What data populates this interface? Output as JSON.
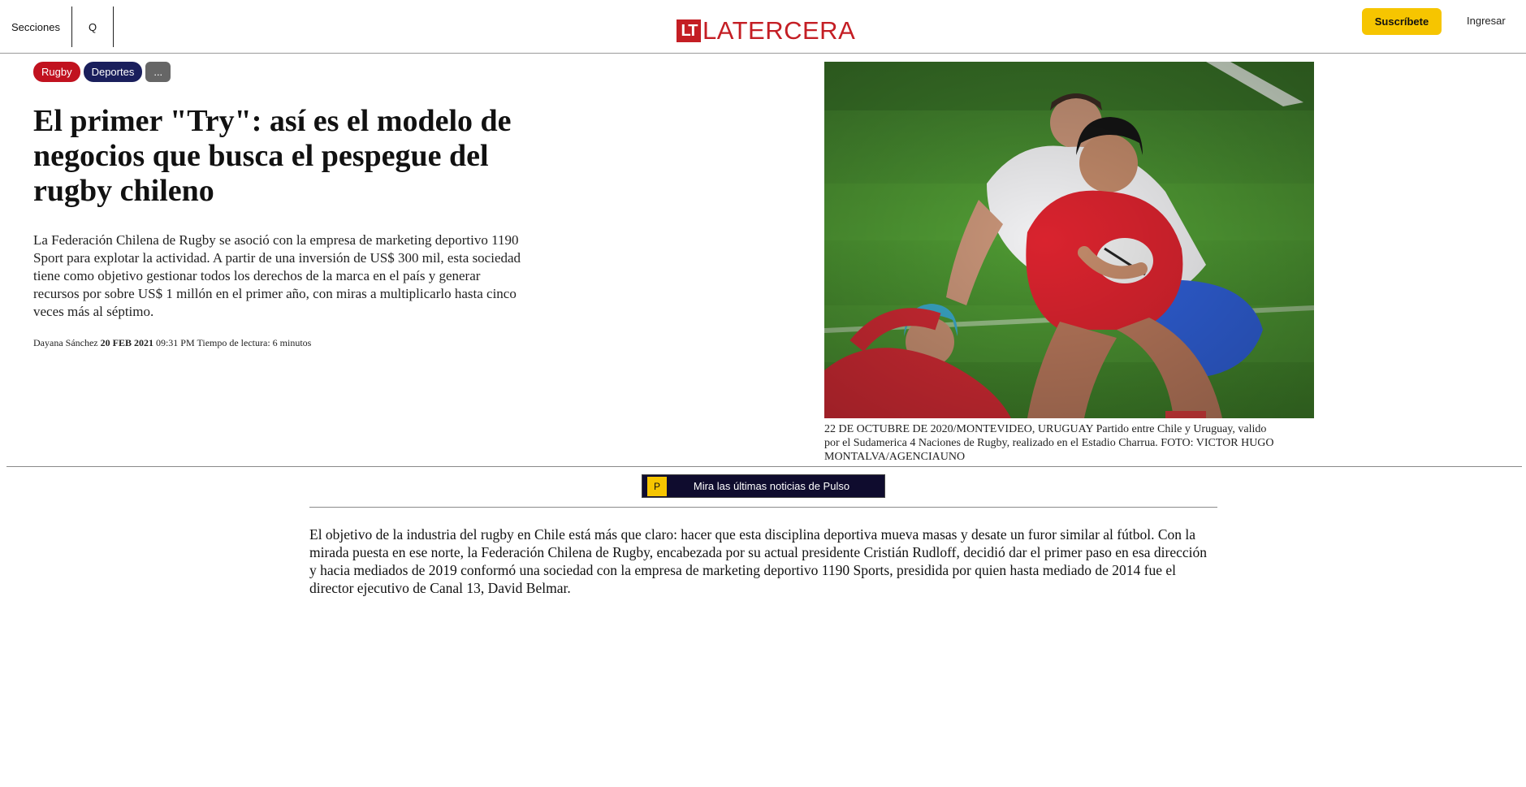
{
  "header": {
    "sections_label": "Secciones",
    "search_label": "Q",
    "logo_mark": "LT",
    "logo_text": "LATERCERA",
    "subscribe_label": "Suscríbete",
    "login_label": "Ingresar"
  },
  "tags": [
    "Rugby",
    "Deportes",
    "..."
  ],
  "article": {
    "headline": "El primer \"Try\": así es el modelo de negocios que busca el pespegue del rugby chileno",
    "lead": "La Federación Chilena de Rugby se asoció con la empresa de marketing deportivo 1190 Sport para explotar la actividad. A partir de una inversión de US$ 300 mil, esta sociedad tiene como objetivo gestionar todos los derechos de la marca en el país y generar recursos por sobre US$ 1 millón en el primer año, con miras a multiplicarlo hasta cinco veces más al séptimo.",
    "author": "Dayana Sánchez",
    "date": "20 FEB 2021",
    "time": "09:31 PM",
    "reading_time": "Tiempo de lectura: 6 minutos",
    "caption": "22 DE OCTUBRE DE 2020/MONTEVIDEO, URUGUAY Partido entre Chile y Uruguay, valido por el Sudamerica 4 Naciones de Rugby, realizado en el Estadio Charrua. FOTO: VICTOR HUGO MONTALVA/AGENCIAUNO",
    "body": "El objetivo de la industria del rugby en Chile está más que claro: hacer que esta disciplina deportiva mueva masas y desate un furor similar al fútbol. Con la mirada puesta en ese norte, la Federación Chilena de Rugby, encabezada por su actual presidente Cristián Rudloff, decidió dar el primer paso en esa dirección y hacia mediados de 2019 conformó una sociedad con la empresa de marketing deportivo 1190 Sports, presidida por quien hasta mediado de 2014 fue el director ejecutivo de Canal 13, David Belmar."
  },
  "pulso": {
    "badge": "P",
    "label": "Mira las últimas noticias de Pulso"
  },
  "colors": {
    "brand_red": "#c41e24",
    "subscribe_yellow": "#f6c500",
    "tag_rugby": "#c1121f",
    "tag_deportes": "#1a1f5c",
    "banner_navy": "#0f0c2e"
  }
}
